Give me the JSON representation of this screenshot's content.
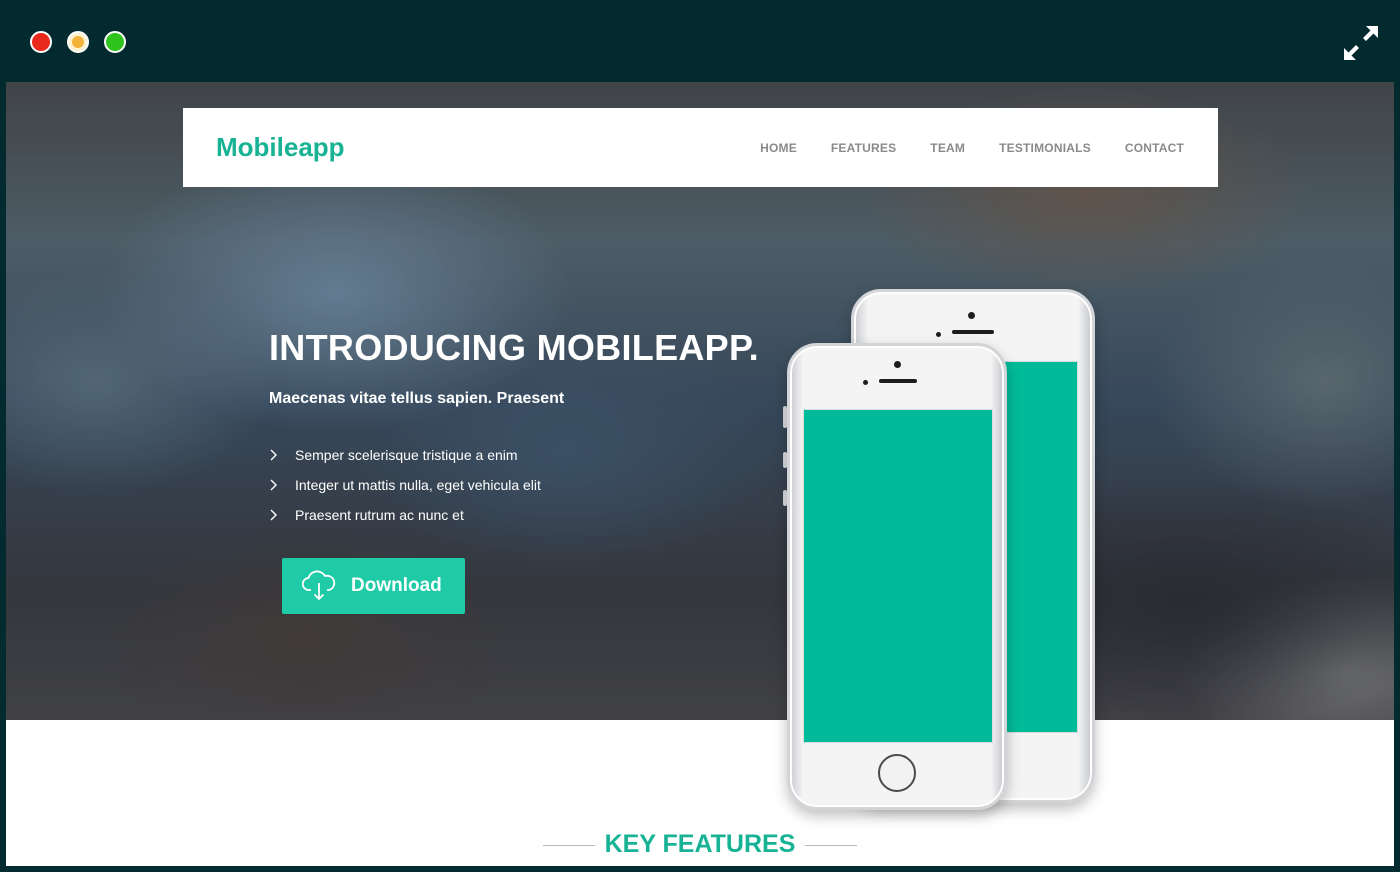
{
  "window": {
    "controls": [
      "close",
      "minimize",
      "maximize"
    ],
    "expand_icon": "expand-icon"
  },
  "navbar": {
    "logo": "Mobileapp",
    "items": [
      {
        "label": "HOME"
      },
      {
        "label": "FEATURES"
      },
      {
        "label": "TEAM"
      },
      {
        "label": "TESTIMONIALS"
      },
      {
        "label": "CONTACT"
      }
    ]
  },
  "hero": {
    "title": "INTRODUCING MOBILEAPP.",
    "subtitle": "Maecenas vitae tellus sapien. Praesent",
    "features": [
      "Semper scelerisque tristique a enim",
      "Integer ut mattis nulla, eget vehicula elit",
      "Praesent rutrum ac nunc et"
    ],
    "download_label": "Download",
    "download_icon": "cloud-download-icon"
  },
  "section": {
    "title": "KEY FEATURES"
  },
  "colors": {
    "brand": "#17b394",
    "button": "#1fcaa6",
    "screen": "#00bb99",
    "frame": "#032a2f",
    "close": "#e8291c",
    "minimize": "#f3b23a",
    "maximize": "#2fc41d"
  }
}
